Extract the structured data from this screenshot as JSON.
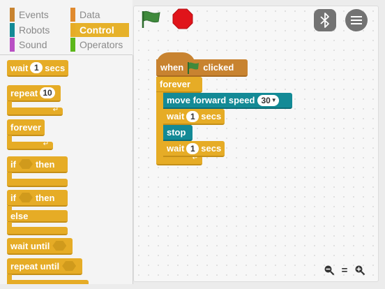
{
  "categories": [
    {
      "label": "Events",
      "color": "#c88330",
      "selected": false
    },
    {
      "label": "Data",
      "color": "#e08a2e",
      "selected": false
    },
    {
      "label": "Robots",
      "color": "#138a96",
      "selected": false
    },
    {
      "label": "Control",
      "color": "#e6ac26",
      "selected": true
    },
    {
      "label": "Sound",
      "color": "#b94fc4",
      "selected": false
    },
    {
      "label": "Operators",
      "color": "#5cb71a",
      "selected": false
    }
  ],
  "palette": {
    "wait": {
      "label": "wait",
      "value": "1",
      "suffix": "secs"
    },
    "repeat": {
      "label": "repeat",
      "value": "10"
    },
    "forever": {
      "label": "forever"
    },
    "if_then": {
      "label": "if",
      "suffix": "then"
    },
    "if_else": {
      "label": "if",
      "suffix": "then",
      "else_label": "else"
    },
    "wait_until": {
      "label": "wait until"
    },
    "repeat_until": {
      "label": "repeat until"
    }
  },
  "script": {
    "hat": {
      "prefix": "when",
      "suffix": "clicked"
    },
    "forever": {
      "label": "forever"
    },
    "move": {
      "label": "move forward speed",
      "value": "30"
    },
    "wait1": {
      "label": "wait",
      "value": "1",
      "suffix": "secs"
    },
    "stop": {
      "label": "stop"
    },
    "wait2": {
      "label": "wait",
      "value": "1",
      "suffix": "secs"
    }
  },
  "toolbar": {
    "flag_icon": "green-flag-icon",
    "stop_icon": "stop-sign-icon",
    "bluetooth_icon": "bluetooth-icon",
    "menu_icon": "hamburger-menu-icon"
  },
  "zoom": {
    "minus_icon": "zoom-out-icon",
    "reset_label": "=",
    "plus_icon": "zoom-in-icon"
  },
  "colors": {
    "control": "#e6ac26",
    "events": "#c88330",
    "robots": "#138a96"
  }
}
